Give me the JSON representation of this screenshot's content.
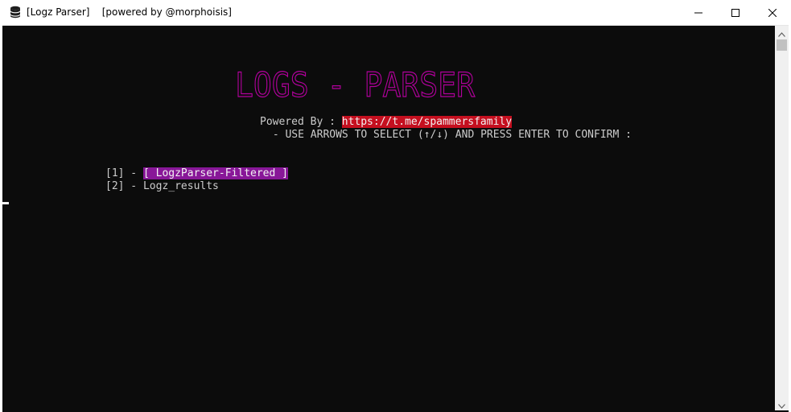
{
  "window": {
    "title": "[Logz Parser]    [powered by @morphoisis]"
  },
  "terminal": {
    "banner": "LOGS - PARSER",
    "powered_by_label": "Powered By : ",
    "powered_by_link": "https://t.me/spammersfamily",
    "instruction": " - USE ARROWS TO SELECT (↑/↓) AND PRESS ENTER TO CONFIRM :",
    "menu": [
      {
        "prefix": "[1] - ",
        "label": "[ LogzParser-Filtered ]",
        "selected": true
      },
      {
        "prefix": "[2] - ",
        "label": "Logz_results",
        "selected": false
      }
    ]
  },
  "colors": {
    "terminal_bg": "#0c0c0c",
    "terminal_fg": "#cccccc",
    "banner_magenta": "#b4009e",
    "link_bg": "#c50f1f",
    "selected_bg": "#881798"
  },
  "icons": {
    "app": "database-icon",
    "minimize": "minimize-icon",
    "maximize": "maximize-icon",
    "close": "close-icon",
    "scroll_up": "scroll-up-arrow-icon",
    "scroll_down": "scroll-down-arrow-icon"
  }
}
